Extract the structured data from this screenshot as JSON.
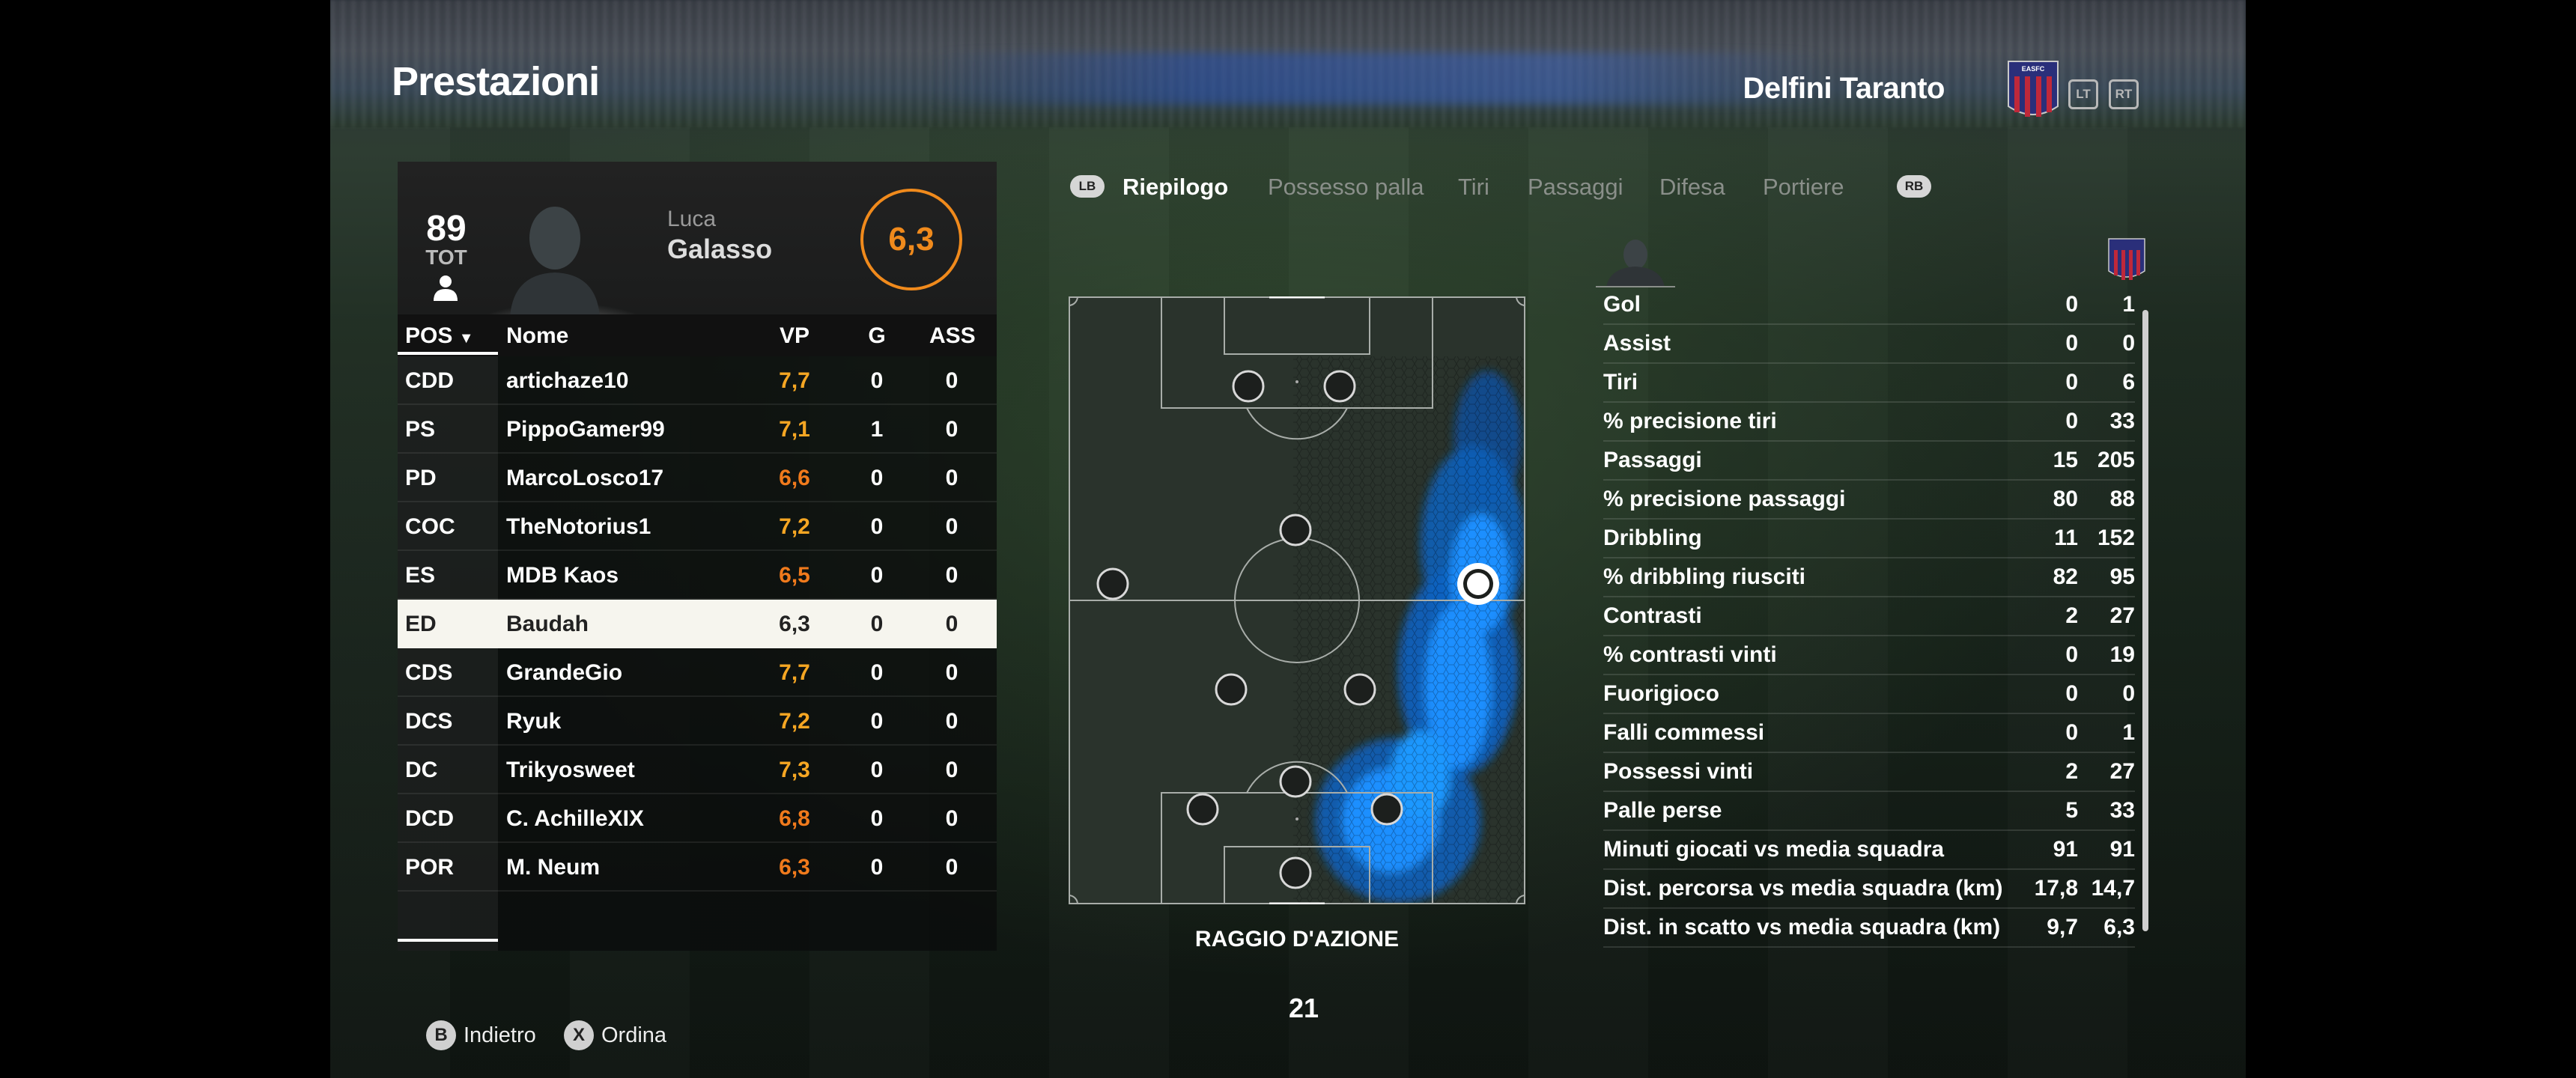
{
  "header": {
    "title": "Prestazioni",
    "team_name": "Delfini Taranto",
    "crest_text": "EASFC",
    "lt": "LT",
    "rt": "RT"
  },
  "player": {
    "overall": "89",
    "overall_label": "TOT",
    "first_name": "Luca",
    "last_name": "Galasso",
    "match_rating": "6,3"
  },
  "table": {
    "headers": {
      "pos": "POS",
      "name": "Nome",
      "vp": "VP",
      "g": "G",
      "ass": "ASS"
    },
    "rows": [
      {
        "pos": "CDD",
        "name": "artichaze10",
        "vp": "7,7",
        "g": "0",
        "ass": "0",
        "vp_color": "#f5a623"
      },
      {
        "pos": "PS",
        "name": "PippoGamer99",
        "vp": "7,1",
        "g": "1",
        "ass": "0",
        "vp_color": "#f5a623"
      },
      {
        "pos": "PD",
        "name": "MarcoLosco17",
        "vp": "6,6",
        "g": "0",
        "ass": "0",
        "vp_color": "#f07a1c"
      },
      {
        "pos": "COC",
        "name": "TheNotorius1",
        "vp": "7,2",
        "g": "0",
        "ass": "0",
        "vp_color": "#f5a623"
      },
      {
        "pos": "ES",
        "name": "MDB Kaos",
        "vp": "6,5",
        "g": "0",
        "ass": "0",
        "vp_color": "#f07a1c"
      },
      {
        "pos": "ED",
        "name": "Baudah",
        "vp": "6,3",
        "g": "0",
        "ass": "0",
        "vp_color": "#222222",
        "selected": true
      },
      {
        "pos": "CDS",
        "name": "GrandeGio",
        "vp": "7,7",
        "g": "0",
        "ass": "0",
        "vp_color": "#f5a623"
      },
      {
        "pos": "DCS",
        "name": "Ryuk",
        "vp": "7,2",
        "g": "0",
        "ass": "0",
        "vp_color": "#f5a623"
      },
      {
        "pos": "DC",
        "name": "Trikyosweet",
        "vp": "7,3",
        "g": "0",
        "ass": "0",
        "vp_color": "#f5a623"
      },
      {
        "pos": "DCD",
        "name": "C. AchilleXIX",
        "vp": "6,8",
        "g": "0",
        "ass": "0",
        "vp_color": "#f07a1c"
      },
      {
        "pos": "POR",
        "name": "M. Neum",
        "vp": "6,3",
        "g": "0",
        "ass": "0",
        "vp_color": "#f07a1c"
      }
    ]
  },
  "tabs": {
    "lb": "LB",
    "rb": "RB",
    "items": [
      "Riepilogo",
      "Possesso palla",
      "Tiri",
      "Passaggi",
      "Difesa",
      "Portiere"
    ],
    "active": "Riepilogo"
  },
  "pitch": {
    "label": "RAGGIO D'AZIONE",
    "heat_color": "#1a8fff"
  },
  "minute": "21",
  "stats": [
    {
      "label": "Gol",
      "player": "0",
      "team": "1"
    },
    {
      "label": "Assist",
      "player": "0",
      "team": "0"
    },
    {
      "label": "Tiri",
      "player": "0",
      "team": "6"
    },
    {
      "label": "% precisione tiri",
      "player": "0",
      "team": "33"
    },
    {
      "label": "Passaggi",
      "player": "15",
      "team": "205"
    },
    {
      "label": "% precisione passaggi",
      "player": "80",
      "team": "88"
    },
    {
      "label": "Dribbling",
      "player": "11",
      "team": "152"
    },
    {
      "label": "% dribbling riusciti",
      "player": "82",
      "team": "95"
    },
    {
      "label": "Contrasti",
      "player": "2",
      "team": "27"
    },
    {
      "label": "% contrasti vinti",
      "player": "0",
      "team": "19"
    },
    {
      "label": "Fuorigioco",
      "player": "0",
      "team": "0"
    },
    {
      "label": "Falli commessi",
      "player": "0",
      "team": "1"
    },
    {
      "label": "Possessi vinti",
      "player": "2",
      "team": "27"
    },
    {
      "label": "Palle perse",
      "player": "5",
      "team": "33"
    },
    {
      "label": "Minuti giocati vs media squadra",
      "player": "91",
      "team": "91"
    },
    {
      "label": "Dist. percorsa vs media squadra (km)",
      "player": "17,8",
      "team": "14,7"
    },
    {
      "label": "Dist. in scatto vs media squadra (km)",
      "player": "9,7",
      "team": "6,3"
    }
  ],
  "footer": {
    "back_key": "B",
    "back_label": "Indietro",
    "sort_key": "X",
    "sort_label": "Ordina"
  }
}
